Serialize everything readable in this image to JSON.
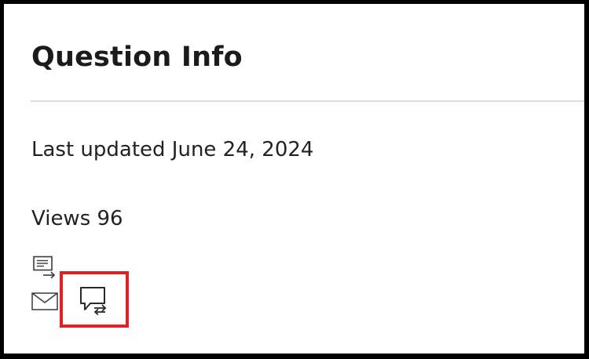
{
  "panel": {
    "title": "Question Info",
    "last_updated": "Last updated June 24, 2024",
    "views": "Views 96"
  },
  "icons": {
    "comment": "comment-link-icon",
    "mail": "mail-icon",
    "share": "chat-share-icon"
  },
  "colors": {
    "frame_border": "#000000",
    "highlight": "#d9222a",
    "text": "#1b1b1b",
    "divider": "#dcdcdc"
  }
}
